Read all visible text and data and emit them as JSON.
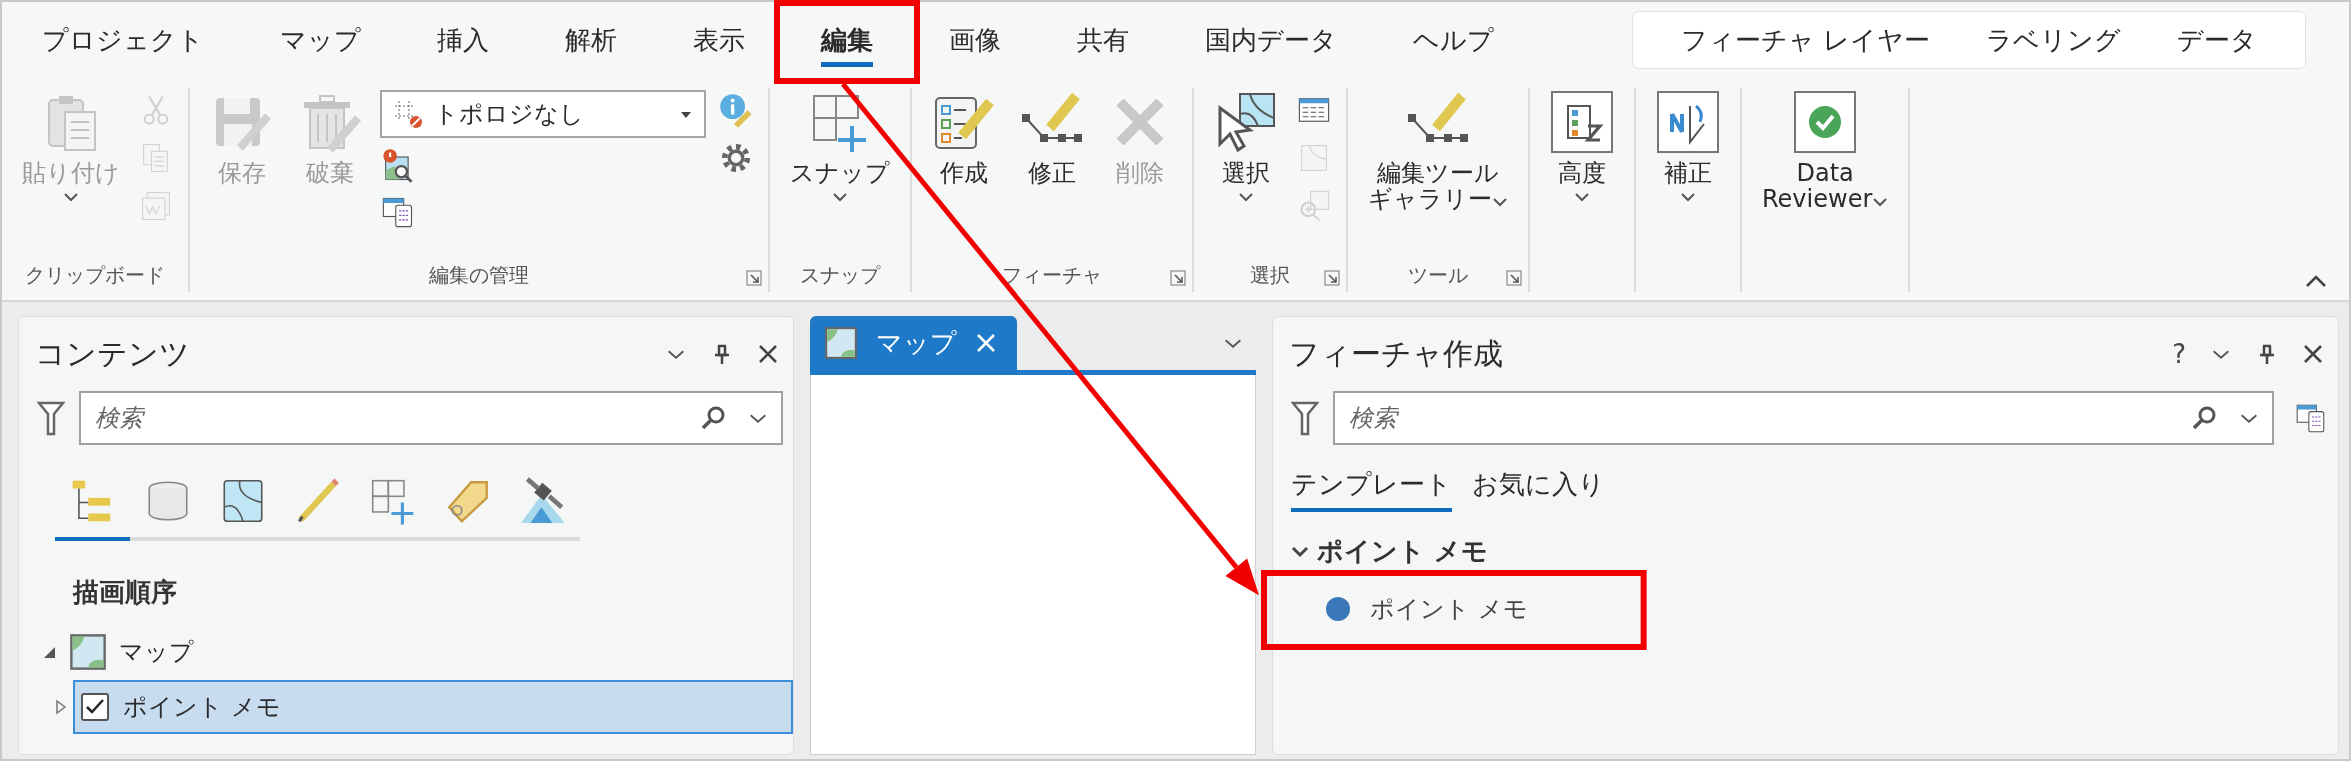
{
  "tabs": [
    {
      "label": "プロジェクト",
      "selected": false,
      "highlighted": false
    },
    {
      "label": "マップ",
      "selected": false,
      "highlighted": false
    },
    {
      "label": "挿入",
      "selected": false,
      "highlighted": false
    },
    {
      "label": "解析",
      "selected": false,
      "highlighted": false
    },
    {
      "label": "表示",
      "selected": false,
      "highlighted": false
    },
    {
      "label": "編集",
      "selected": true,
      "highlighted": true
    },
    {
      "label": "画像",
      "selected": false,
      "highlighted": false
    },
    {
      "label": "共有",
      "selected": false,
      "highlighted": false
    },
    {
      "label": "国内データ",
      "selected": false,
      "highlighted": false
    },
    {
      "label": "ヘルプ",
      "selected": false,
      "highlighted": false
    }
  ],
  "contextual_tabs": [
    {
      "label": "フィーチャ レイヤー"
    },
    {
      "label": "ラベリング"
    },
    {
      "label": "データ"
    }
  ],
  "ribbon_groups": [
    {
      "label": "クリップボード",
      "launcher": false,
      "items": [
        {
          "kind": "large",
          "label": "貼り付け",
          "disabled": true,
          "dropdown": true
        },
        {
          "kind": "small",
          "icons": [
            {
              "disabled": true
            },
            {
              "disabled": true
            },
            {
              "disabled": true
            }
          ]
        }
      ]
    },
    {
      "label": "編集の管理",
      "launcher": true,
      "items": [
        {
          "kind": "large",
          "label": "保存",
          "disabled": true,
          "dropdown": false
        },
        {
          "kind": "large",
          "label": "破棄",
          "disabled": true,
          "dropdown": false
        },
        {
          "kind": "combo",
          "value": "トポロジなし",
          "icons": [
            {
              "disabled": false
            },
            {
              "disabled": false
            }
          ]
        },
        {
          "kind": "small",
          "icons": [
            {
              "disabled": false
            },
            {
              "disabled": false
            }
          ]
        }
      ]
    },
    {
      "label": "スナップ",
      "launcher": false,
      "items": [
        {
          "kind": "large",
          "label": "スナップ",
          "disabled": false,
          "dropdown": true
        }
      ]
    },
    {
      "label": "フィーチャ",
      "launcher": true,
      "items": [
        {
          "kind": "large",
          "label": "作成",
          "disabled": false,
          "dropdown": false
        },
        {
          "kind": "large",
          "label": "修正",
          "disabled": false,
          "dropdown": false
        },
        {
          "kind": "large",
          "label": "削除",
          "disabled": true,
          "dropdown": false
        }
      ]
    },
    {
      "label": "選択",
      "launcher": true,
      "items": [
        {
          "kind": "large",
          "label": "選択",
          "disabled": false,
          "dropdown": true
        },
        {
          "kind": "small",
          "icons": [
            {
              "disabled": false
            },
            {
              "disabled": true
            },
            {
              "disabled": true
            }
          ]
        }
      ]
    },
    {
      "label": "ツール",
      "launcher": true,
      "items": [
        {
          "kind": "large",
          "lines": [
            "編集ツール",
            "ギャラリー"
          ],
          "disabled": false,
          "dropdown": true
        }
      ]
    },
    {
      "items": [
        {
          "kind": "boxed",
          "label": "高度",
          "disabled": false,
          "dropdown": true
        }
      ]
    },
    {
      "items": [
        {
          "kind": "boxed",
          "label": "補正",
          "disabled": false,
          "dropdown": true
        }
      ]
    },
    {
      "items": [
        {
          "kind": "boxed",
          "label": "Data\nReviewer",
          "disabled": false,
          "dropdown": true
        }
      ]
    }
  ],
  "contents_pane": {
    "title": "コンテンツ",
    "search": {
      "placeholder": "検索"
    },
    "view_tabs": [
      {
        "selected": true
      },
      {
        "selected": false
      },
      {
        "selected": false
      },
      {
        "selected": false
      },
      {
        "selected": false
      },
      {
        "selected": false
      },
      {
        "selected": false
      }
    ],
    "heading": "描画順序",
    "layers": [
      {
        "kind": "map",
        "label": "マップ",
        "expanded": true,
        "children": [
          {
            "kind": "layer",
            "label": "ポイント メモ",
            "checked": true,
            "selected": true,
            "expanded": false
          }
        ]
      }
    ]
  },
  "map_view": {
    "tabs": [
      {
        "label": "マップ",
        "selected": true
      }
    ]
  },
  "create_features_pane": {
    "title": "フィーチャ作成",
    "help": "?",
    "search": {
      "placeholder": "検索"
    },
    "tabs": [
      {
        "label": "テンプレート",
        "selected": true
      },
      {
        "label": "お気に入り",
        "selected": false
      }
    ],
    "templates": [
      {
        "label": "ポイント メモ",
        "expanded": true,
        "children": [
          {
            "label": "ポイント メモ",
            "color": "#3b78b9",
            "highlighted": true
          }
        ]
      }
    ]
  }
}
